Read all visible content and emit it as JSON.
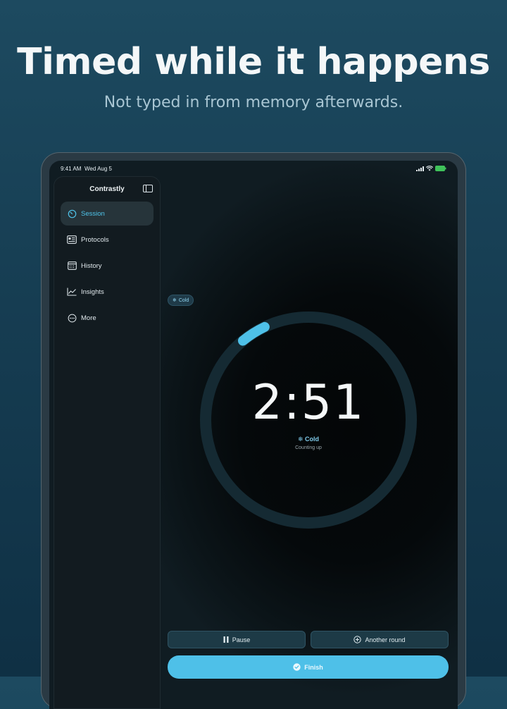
{
  "hero": {
    "headline": "Timed while it happens",
    "subline": "Not typed in from memory afterwards."
  },
  "status_bar": {
    "time": "9:41 AM",
    "date": "Wed Aug 5"
  },
  "sidebar": {
    "title": "Contrastly",
    "items": [
      {
        "label": "Session",
        "icon": "timer-icon",
        "active": true
      },
      {
        "label": "Protocols",
        "icon": "protocols-icon",
        "active": false
      },
      {
        "label": "History",
        "icon": "calendar-icon",
        "active": false
      },
      {
        "label": "Insights",
        "icon": "chart-icon",
        "active": false
      },
      {
        "label": "More",
        "icon": "more-icon",
        "active": false
      }
    ]
  },
  "session": {
    "chip_label": "Cold",
    "timer": "2:51",
    "phase_label": "Cold",
    "mode_label": "Counting up",
    "progress_fraction": 0.04
  },
  "actions": {
    "pause_label": "Pause",
    "another_round_label": "Another round",
    "finish_label": "Finish"
  },
  "colors": {
    "accent": "#4ec0e8",
    "ring_track": "#152a33",
    "background_top": "#1d4a60"
  }
}
